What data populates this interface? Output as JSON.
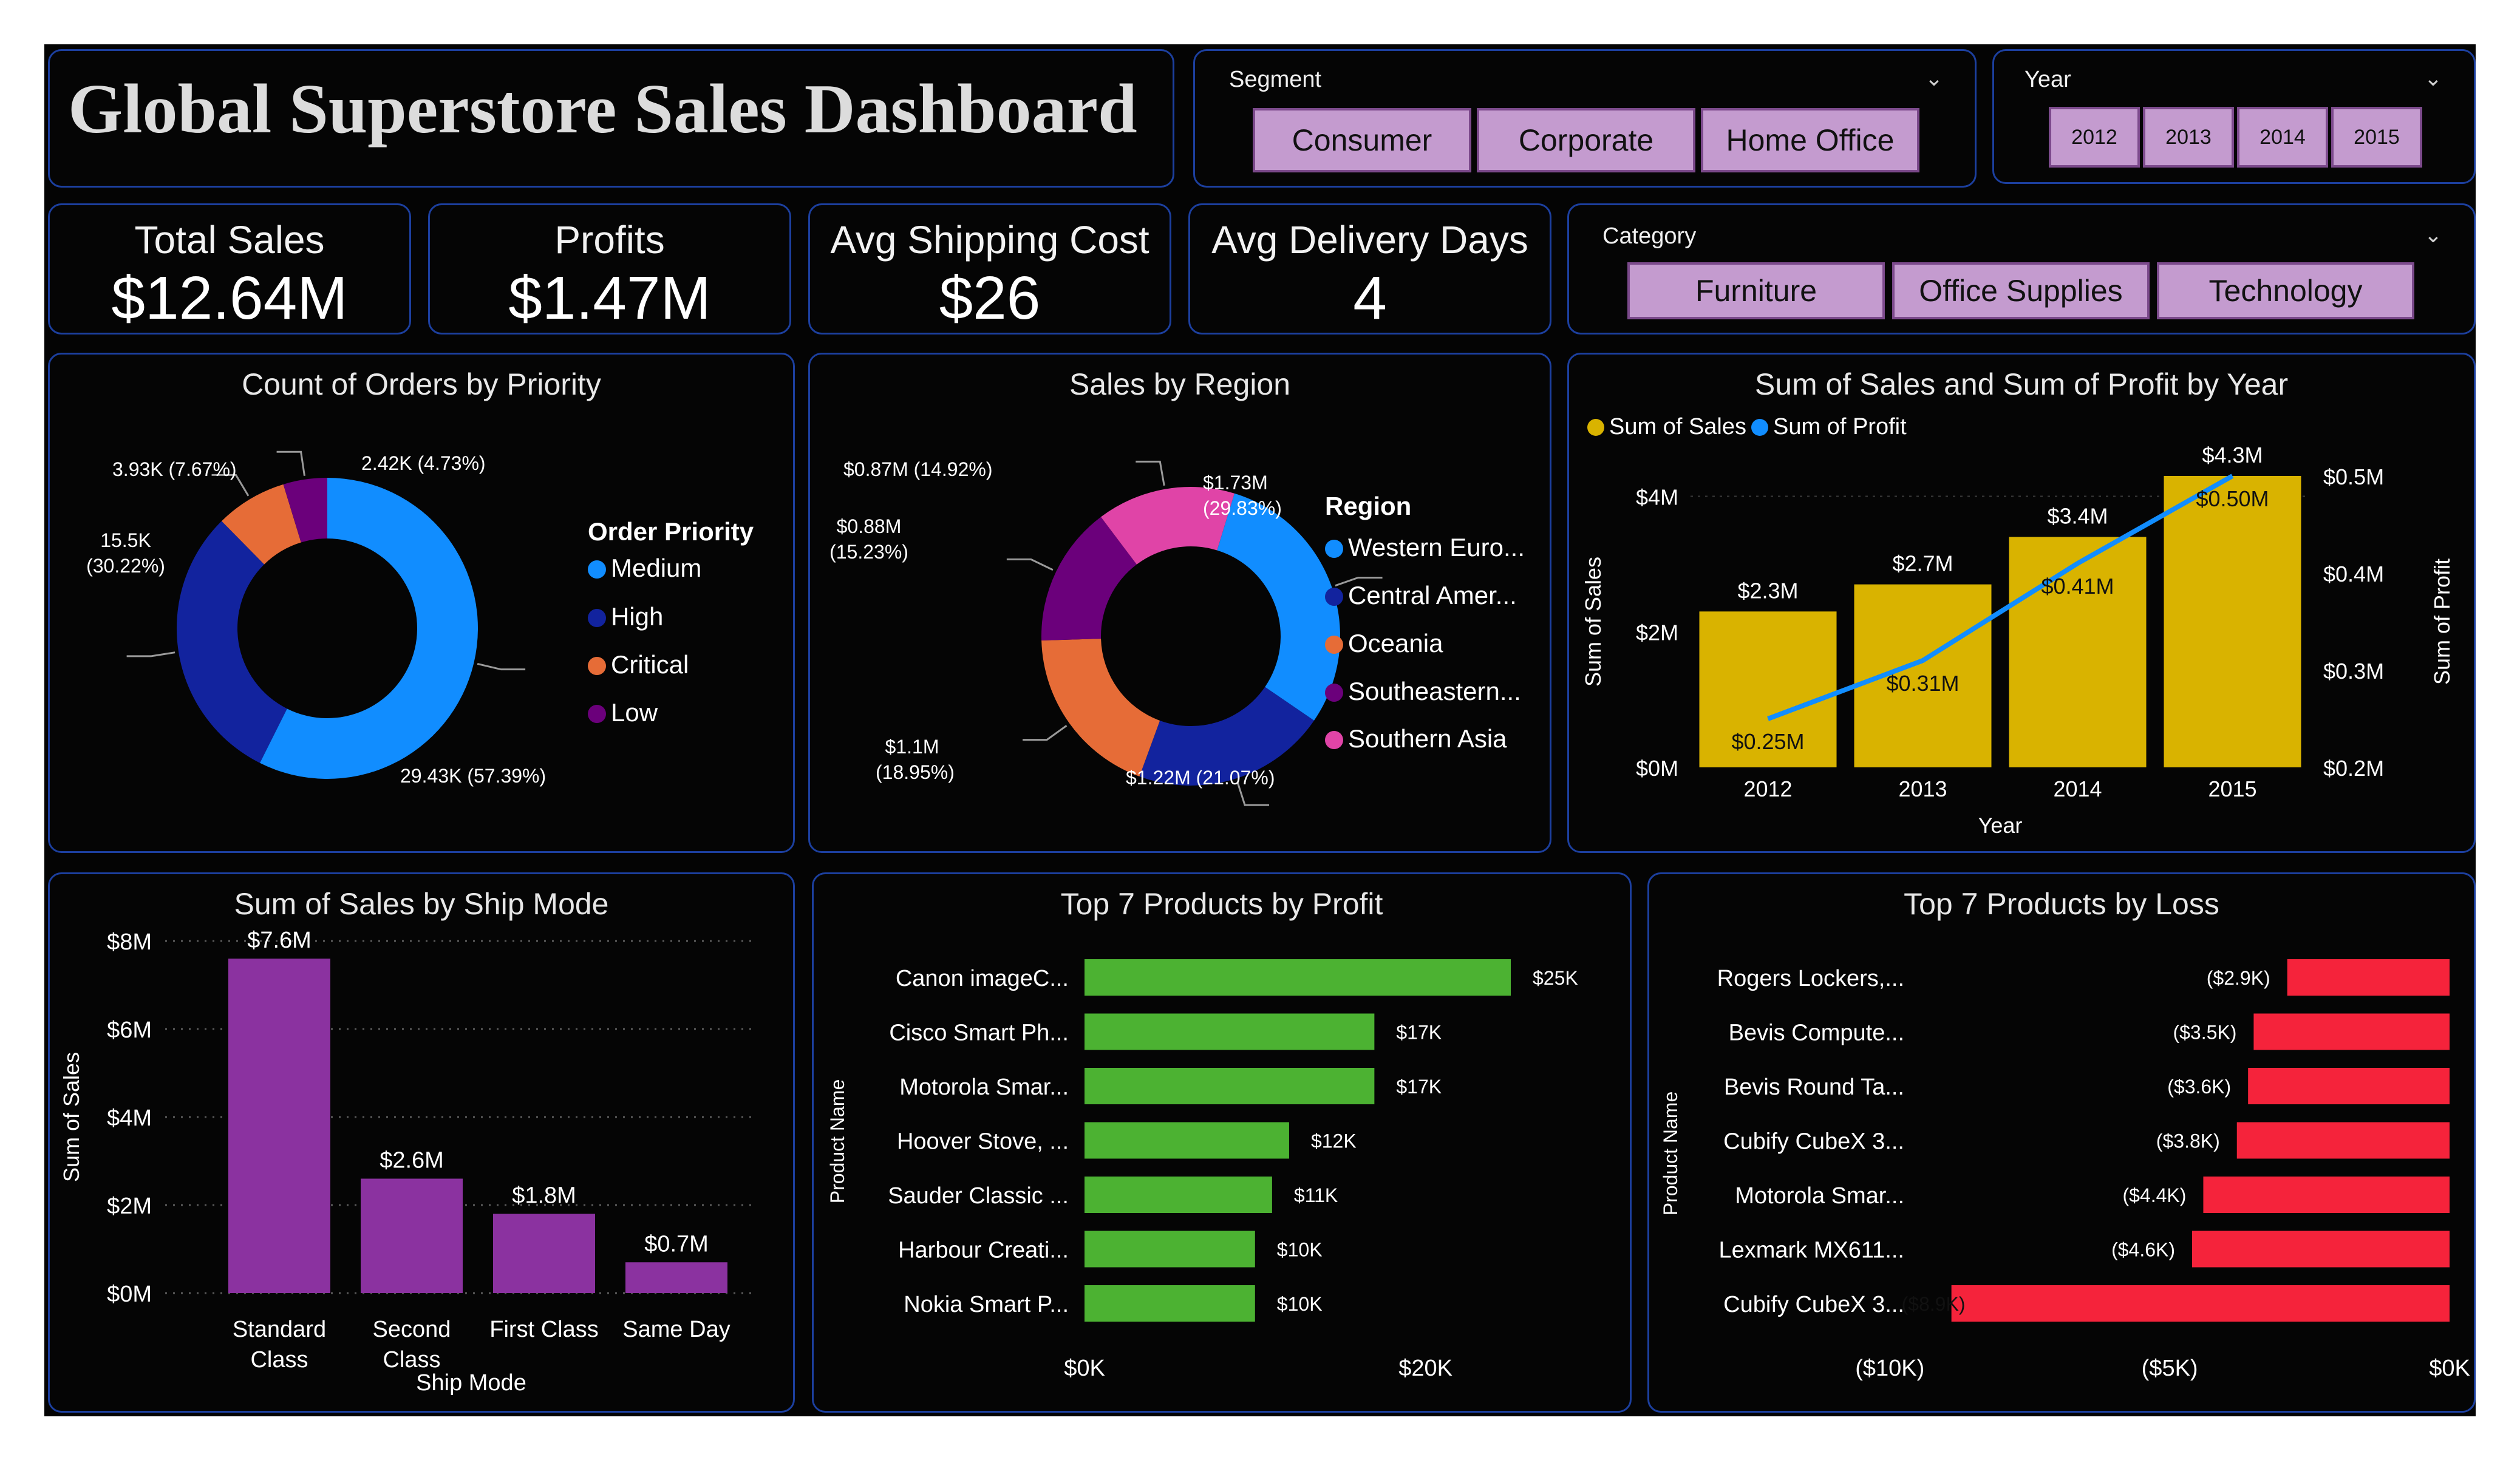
{
  "dashboard": {
    "title": "Global Superstore Sales Dashboard",
    "colors": {
      "background": "#040404",
      "panel_border": "#1c3f9e",
      "chip_bg": "#c49bcf",
      "chip_border": "#7c4a8c"
    }
  },
  "segment_slicer": {
    "label": "Segment",
    "icon": "chevron-down-icon",
    "options": [
      "Consumer",
      "Corporate",
      "Home Office"
    ]
  },
  "year_slicer": {
    "label": "Year",
    "icon": "chevron-down-icon",
    "options": [
      "2012",
      "2013",
      "2014",
      "2015"
    ]
  },
  "category_slicer": {
    "label": "Category",
    "icon": "chevron-down-icon",
    "options": [
      "Furniture",
      "Office Supplies",
      "Technology"
    ]
  },
  "kpis": [
    {
      "label": "Total Sales",
      "value": "$12.64M"
    },
    {
      "label": "Profits",
      "value": "$1.47M"
    },
    {
      "label": "Avg Shipping Cost",
      "value": "$26"
    },
    {
      "label": "Avg Delivery Days",
      "value": "4"
    }
  ],
  "chart_data": [
    {
      "id": "priority",
      "type": "pie",
      "title": "Count of Orders by Priority",
      "legend_title": "Order Priority",
      "legend_position": "right",
      "categories": [
        "Medium",
        "High",
        "Critical",
        "Low"
      ],
      "values": [
        29.43,
        15.5,
        3.93,
        2.42
      ],
      "unit": "K",
      "labels": [
        "29.43K (57.39%)",
        "15.5K (30.22%)",
        "3.93K (7.67%)",
        "2.42K (4.73%)"
      ],
      "colors": [
        "#118dff",
        "#12239e",
        "#e66c37",
        "#6b007b"
      ]
    },
    {
      "id": "region",
      "type": "pie",
      "title": "Sales by Region",
      "legend_title": "Region",
      "legend_position": "right",
      "categories": [
        "Western Euro...",
        "Central Amer...",
        "Oceania",
        "Southeastern...",
        "Southern Asia"
      ],
      "values": [
        1.73,
        1.22,
        1.1,
        0.88,
        0.87
      ],
      "unit": "$M",
      "labels": [
        "$1.73M (29.83%)",
        "$1.22M (21.07%)",
        "$1.1M (18.95%)",
        "$0.88M (15.23%)",
        "$0.87M (14.92%)"
      ],
      "colors": [
        "#118dff",
        "#12239e",
        "#e66c37",
        "#6b007b",
        "#e044a7"
      ]
    },
    {
      "id": "year",
      "type": "bar",
      "title": "Sum of Sales and Sum of Profit by Year",
      "xlabel": "Year",
      "ylabel": "Sum of Sales",
      "y2label": "Sum of Profit",
      "categories": [
        "2012",
        "2013",
        "2014",
        "2015"
      ],
      "series": [
        {
          "name": "Sum of Sales",
          "type": "bar",
          "values": [
            2.3,
            2.7,
            3.4,
            4.3
          ],
          "labels": [
            "$2.3M",
            "$2.7M",
            "$3.4M",
            "$4.3M"
          ],
          "color": "#d9b300"
        },
        {
          "name": "Sum of Profit",
          "type": "line",
          "values": [
            0.25,
            0.31,
            0.41,
            0.5
          ],
          "labels": [
            "$0.25M",
            "$0.31M",
            "$0.41M",
            "$0.50M"
          ],
          "color": "#118dff"
        }
      ],
      "ylim": [
        0,
        4.3
      ],
      "y2lim": [
        0.2,
        0.5
      ],
      "yticks": [
        "$0M",
        "$2M",
        "$4M"
      ],
      "y2ticks": [
        "$0.2M",
        "$0.3M",
        "$0.4M",
        "$0.5M"
      ],
      "legend_position": "top-left"
    },
    {
      "id": "shipmode",
      "type": "bar",
      "title": "Sum of Sales by Ship Mode",
      "xlabel": "Ship Mode",
      "ylabel": "Sum of Sales",
      "categories": [
        [
          "Standard",
          "Class"
        ],
        [
          "Second",
          "Class"
        ],
        [
          "First Class"
        ],
        [
          "Same Day"
        ]
      ],
      "values": [
        7.6,
        2.6,
        1.8,
        0.7
      ],
      "labels": [
        "$7.6M",
        "$2.6M",
        "$1.8M",
        "$0.7M"
      ],
      "yticks": [
        "$0M",
        "$2M",
        "$4M",
        "$6M",
        "$8M"
      ],
      "ylim": [
        0,
        8
      ],
      "grid": true,
      "color": "#8b32a0"
    },
    {
      "id": "topprofit",
      "type": "bar",
      "orientation": "horizontal",
      "title": "Top 7 Products by Profit",
      "ylabel": "Product Name",
      "categories": [
        "Canon imageC...",
        "Cisco Smart Ph...",
        "Motorola Smar...",
        "Hoover Stove, ...",
        "Sauder Classic ...",
        "Harbour Creati...",
        "Nokia Smart P..."
      ],
      "values": [
        25,
        17,
        17,
        12,
        11,
        10,
        10
      ],
      "labels": [
        "$25K",
        "$17K",
        "$17K",
        "$12K",
        "$11K",
        "$10K",
        "$10K"
      ],
      "xticks": [
        "$0K",
        "$20K"
      ],
      "xlim": [
        0,
        25
      ],
      "color": "#4cb232"
    },
    {
      "id": "toploss",
      "type": "bar",
      "orientation": "horizontal",
      "title": "Top 7 Products by Loss",
      "ylabel": "Product Name",
      "categories": [
        "Rogers Lockers,...",
        "Bevis Compute...",
        "Bevis Round Ta...",
        "Cubify CubeX 3...",
        "Motorola Smar...",
        "Lexmark MX611...",
        "Cubify CubeX 3..."
      ],
      "values": [
        -2.9,
        -3.5,
        -3.6,
        -3.8,
        -4.4,
        -4.6,
        -8.9
      ],
      "labels": [
        "($2.9K)",
        "($3.5K)",
        "($3.6K)",
        "($3.8K)",
        "($4.4K)",
        "($4.6K)",
        "($8.9K)"
      ],
      "xticks": [
        "($10K)",
        "($5K)",
        "$0K"
      ],
      "xlim": [
        -11.5,
        0
      ],
      "color": "#f5233b"
    }
  ]
}
